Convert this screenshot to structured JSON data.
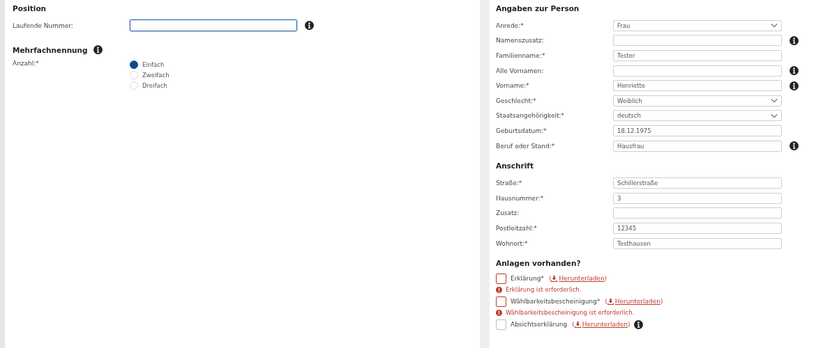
{
  "left_panel": {
    "sections": [
      {
        "title": "Position",
        "info": false,
        "fields": [
          {
            "label": "Laufende Nummer:",
            "kind": "text",
            "focused": true,
            "info": true
          }
        ]
      },
      {
        "title": "Mehrfachnennung",
        "info": true,
        "fields": [
          {
            "label": "Anzahl:*",
            "kind": "radio",
            "options": [
              {
                "label": "Einfach",
                "selected": true
              },
              {
                "label": "Zweifach",
                "selected": false
              },
              {
                "label": "Dreifach",
                "selected": false
              }
            ]
          }
        ]
      }
    ]
  },
  "right_panel": {
    "sections": [
      {
        "title": "Angaben zur Person",
        "info": false,
        "fields": [
          {
            "label": "Anrede:*",
            "kind": "select",
            "value": "Frau",
            "info": false
          },
          {
            "label": "Namenszusatz:",
            "kind": "text",
            "info": true
          },
          {
            "label": "Familienname:*",
            "kind": "text",
            "value": "Tester",
            "info": false
          },
          {
            "label": "Alle Vornamen:",
            "kind": "text",
            "info": true
          },
          {
            "label": "Vorname:*",
            "kind": "text",
            "value": "Henriette",
            "info": true
          },
          {
            "label": "Geschlecht:*",
            "kind": "select",
            "value": "Weiblich",
            "info": false
          },
          {
            "label": "Staatsangehörigkeit:*",
            "kind": "select",
            "value": "deutsch",
            "info": false
          },
          {
            "label": "Geburtsdatum:*",
            "kind": "text",
            "value": "18.12.1975",
            "info": false
          },
          {
            "label": "Beruf oder Stand:*",
            "kind": "text",
            "value": "Hausfrau",
            "info": true
          }
        ]
      },
      {
        "title": "Anschrift",
        "info": false,
        "fields": [
          {
            "label": "Straße:*",
            "kind": "text",
            "value": "Schillerstraße",
            "info": false
          },
          {
            "label": "Hausnummer:*",
            "kind": "text",
            "value": "3",
            "info": false
          },
          {
            "label": "Zusatz:",
            "kind": "text",
            "info": false
          },
          {
            "label": "Postleitzahl:*",
            "kind": "text",
            "value": "12345",
            "info": false
          },
          {
            "label": "Wohnort:*",
            "kind": "text",
            "value": "Testhausen",
            "info": false
          }
        ]
      },
      {
        "title": "Anlagen vorhanden?",
        "info": false,
        "fields": [
          {
            "label": "Erklärung*",
            "kind": "attachment",
            "checked": false,
            "invalid": true,
            "open": "(",
            "link": "Herunterladen",
            "close": ")",
            "info": false,
            "error": "Erklärung ist erforderlich."
          },
          {
            "label": "Wählbarkeitsbescheinigung*",
            "kind": "attachment",
            "checked": false,
            "invalid": true,
            "open": "(",
            "link": "Herunterladen",
            "close": ")",
            "info": false,
            "error": "Wählbarkeitsbescheinigung ist erforderlich."
          },
          {
            "label": "Absichtserklärung",
            "kind": "attachment",
            "checked": false,
            "invalid": false,
            "open": "(",
            "link": "Herunterladen",
            "close": ")",
            "info": true
          }
        ]
      }
    ]
  }
}
